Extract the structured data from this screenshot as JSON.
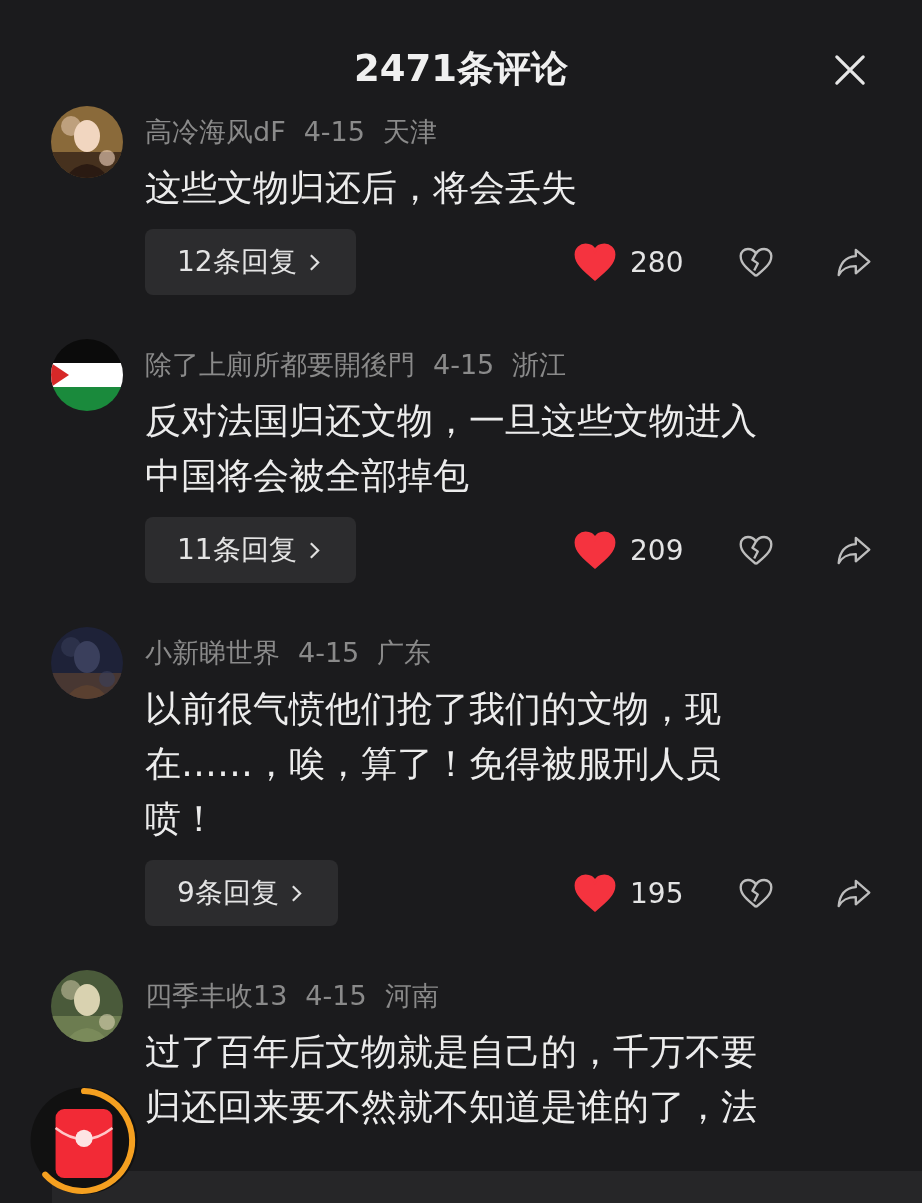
{
  "header": {
    "title": "2471条评论"
  },
  "comments": [
    {
      "avatar": {
        "kind": "picture"
      },
      "name": "高冷海风dF",
      "date": "4-15",
      "location": "天津",
      "lines": [
        "这些文物归还后，将会丢失"
      ],
      "replies": "12条回复",
      "liked": true,
      "likes": "280"
    },
    {
      "avatar": {
        "kind": "flag"
      },
      "name": "除了上廁所都要開後門",
      "date": "4-15",
      "location": "浙江",
      "lines": [
        "反对法国归还文物，一旦这些文物进入",
        "中国将会被全部掉包"
      ],
      "replies": "11条回复",
      "liked": true,
      "likes": "209"
    },
    {
      "avatar": {
        "kind": "picture"
      },
      "name": "小新睇世界",
      "date": "4-15",
      "location": "广东",
      "lines": [
        "以前很气愤他们抢了我们的文物，现",
        "在……，唉，算了！免得被服刑人员",
        "喷！"
      ],
      "replies": "9条回复",
      "liked": true,
      "likes": "195"
    },
    {
      "avatar": {
        "kind": "picture"
      },
      "name": "四季丰收13",
      "date": "4-15",
      "location": "河南",
      "lines": [
        "过了百年后文物就是自己的，千万不要",
        "归还回来要不然就不知道是谁的了，法"
      ]
    }
  ]
}
